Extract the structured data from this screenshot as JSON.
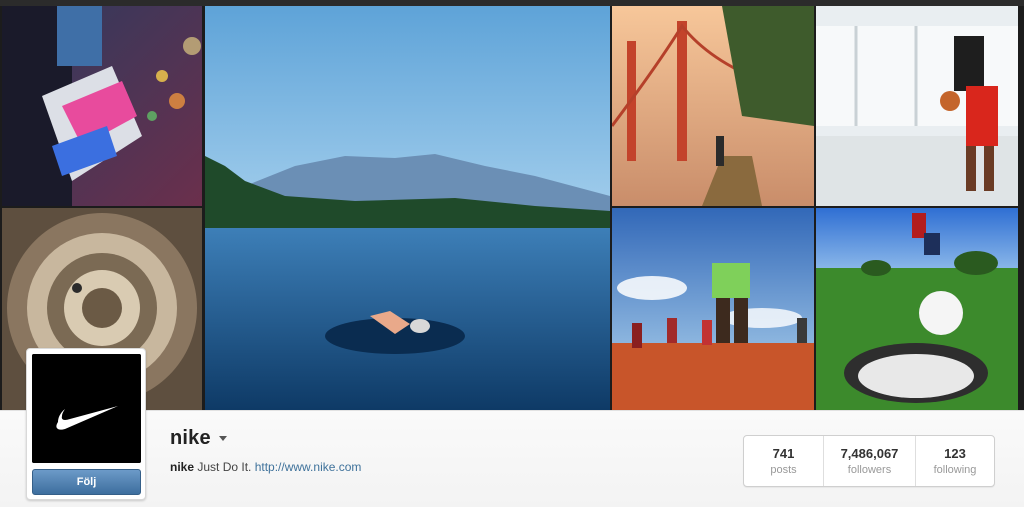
{
  "profile": {
    "username": "nike",
    "bio_name": "nike",
    "bio_text": " Just Do It. ",
    "bio_link": "http://www.nike.com",
    "follow_label": "Följ"
  },
  "stats": [
    {
      "count": "741",
      "label": "posts"
    },
    {
      "count": "7,486,067",
      "label": "followers"
    },
    {
      "count": "123",
      "label": "following"
    }
  ],
  "icons": {
    "logo": "nike-swoosh-icon",
    "username_menu": "caret-down-icon"
  },
  "colors": {
    "follow_button": "#4a7bac",
    "link": "#3f729b"
  }
}
